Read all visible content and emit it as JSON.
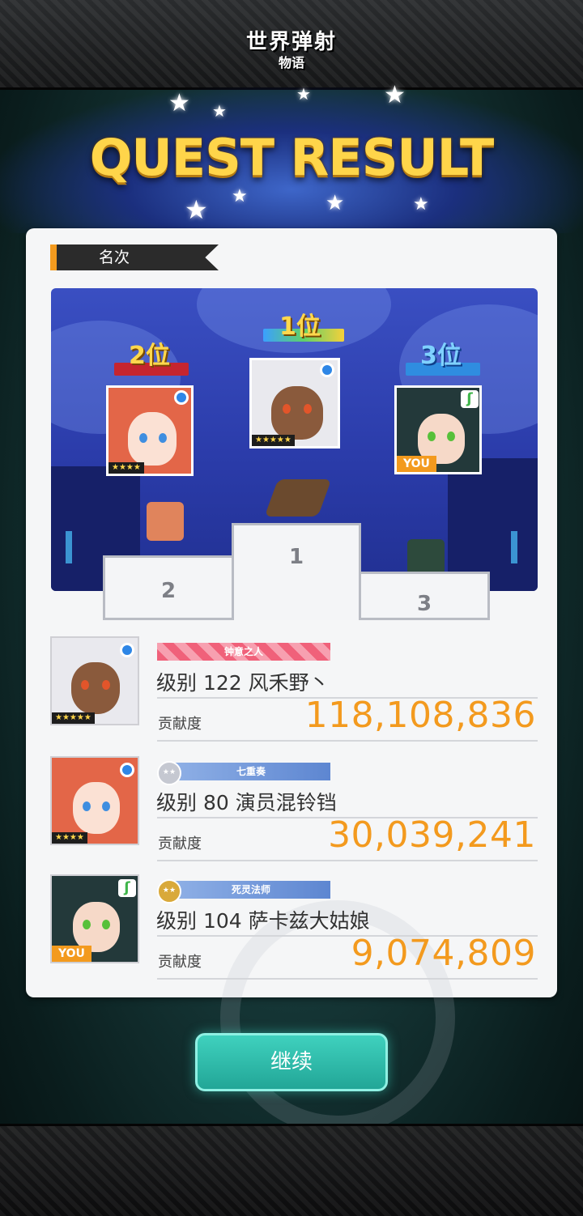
{
  "header": {
    "logo_line1": "世界弹射",
    "logo_line2": "物语",
    "title": "QUEST RESULT"
  },
  "section_label": "名次",
  "podium": {
    "first_label": "1位",
    "second_label": "2位",
    "third_label": "3位",
    "first_stars": "★★★★★",
    "second_stars": "★★★★",
    "third_tag": "YOU",
    "num1": "1",
    "num2": "2",
    "num3": "3"
  },
  "results": [
    {
      "title_badge": "钟意之人",
      "name": "级别 122 风禾野丶",
      "contrib_label": "贡献度",
      "contrib": "118,108,836",
      "stars": "★★★★★"
    },
    {
      "title_badge": "七重奏",
      "name": "级别 80 演员混铃铛",
      "contrib_label": "贡献度",
      "contrib": "30,039,241",
      "stars": "★★★★"
    },
    {
      "title_badge": "死灵法师",
      "name": "级别 104 萨卡兹大姑娘",
      "contrib_label": "贡献度",
      "contrib": "9,074,809",
      "tag": "YOU"
    }
  ],
  "continue_label": "继续",
  "colors": {
    "accent_orange": "#f39a1e",
    "teal_button": "#2bbdaa",
    "title_gold": "#ffd54a"
  }
}
